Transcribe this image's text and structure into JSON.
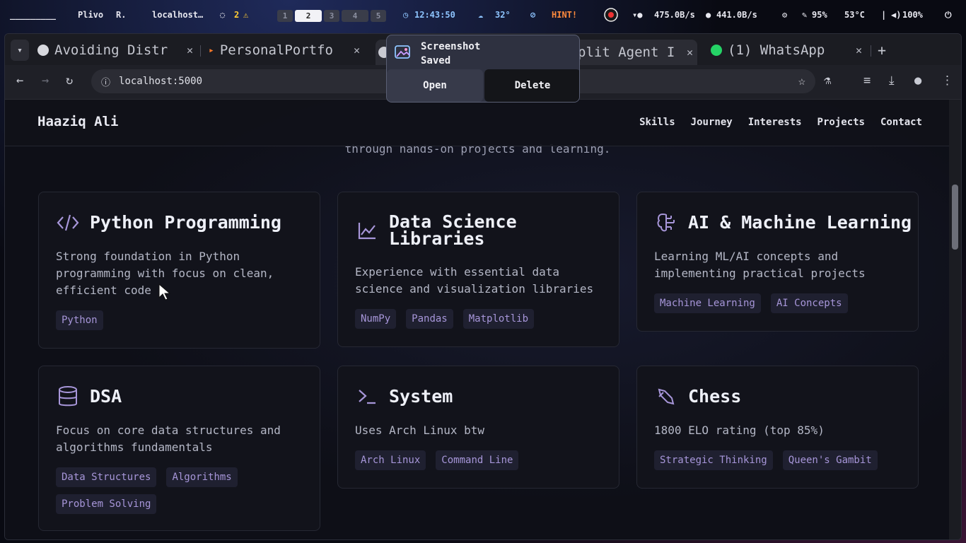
{
  "topbar": {
    "workspace_label": "_________",
    "app1": "Plivo",
    "app1_suffix": "R.",
    "window_title": "localhost…",
    "notif_count": "2",
    "workspaces": [
      "1",
      "2",
      "3",
      "4",
      "5"
    ],
    "time": "12:43:50",
    "weather": "32°",
    "hint": "HINT!",
    "net_down": "475.0B/s",
    "net_up": "441.0B/s",
    "cpu": "95%",
    "temp": "53°C",
    "volume": "100%"
  },
  "browser": {
    "tabs": [
      {
        "title": "Avoiding Distr"
      },
      {
        "title": "PersonalPortfo"
      },
      {
        "title": "plit Agent I"
      },
      {
        "title": "(1) WhatsApp"
      }
    ],
    "url": "localhost:5000"
  },
  "notification": {
    "title": "Screenshot",
    "subtitle": "Saved",
    "open_label": "Open",
    "delete_label": "Delete"
  },
  "site": {
    "brand": "Haaziq Ali",
    "nav": [
      "Skills",
      "Journey",
      "Interests",
      "Projects",
      "Contact"
    ],
    "behind_text": "through hands-on projects and learning.",
    "cards": [
      {
        "title": "Python Programming",
        "desc": "Strong foundation in Python programming with focus on clean, efficient code",
        "tags": [
          "Python"
        ]
      },
      {
        "title": "Data Science Libraries",
        "desc": "Experience with essential data science and visualization libraries",
        "tags": [
          "NumPy",
          "Pandas",
          "Matplotlib"
        ]
      },
      {
        "title": "AI & Machine Learning",
        "desc": "Learning ML/AI concepts and implementing practical projects",
        "tags": [
          "Machine Learning",
          "AI Concepts"
        ]
      },
      {
        "title": "DSA",
        "desc": "Focus on core data structures and algorithms fundamentals",
        "tags": [
          "Data Structures",
          "Algorithms",
          "Problem Solving"
        ]
      },
      {
        "title": "System",
        "desc": "Uses Arch Linux btw",
        "tags": [
          "Arch Linux",
          "Command Line"
        ]
      },
      {
        "title": "Chess",
        "desc": "1800 ELO rating (top 85%)",
        "tags": [
          "Strategic Thinking",
          "Queen's Gambit"
        ]
      }
    ]
  },
  "colors": {
    "accent": "#a796d9",
    "hint": "#ff8a3d"
  }
}
